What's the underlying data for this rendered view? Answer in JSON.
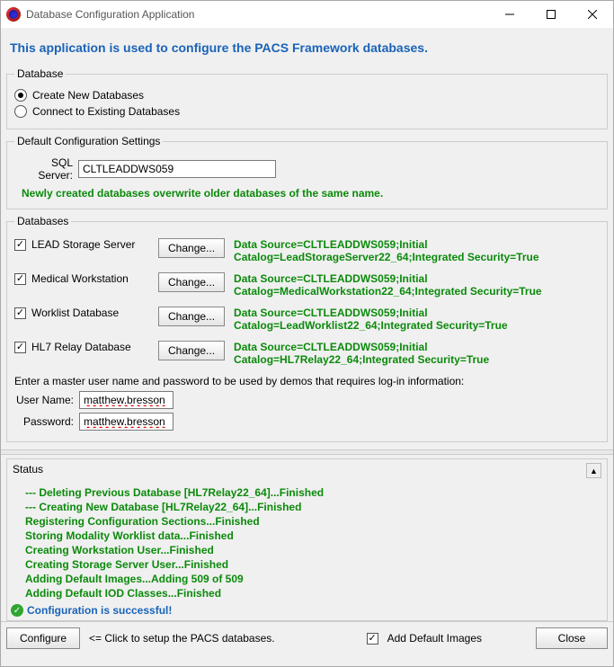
{
  "window": {
    "title": "Database Configuration Application"
  },
  "banner": "This application is used to configure the PACS Framework databases.",
  "database_group": {
    "legend": "Database",
    "opt_create": "Create New Databases",
    "opt_connect": "Connect to Existing Databases"
  },
  "config_group": {
    "legend": "Default Configuration Settings",
    "sql_label": "SQL Server:",
    "sql_value": "CLTLEADDWS059",
    "warning": "Newly created databases overwrite older databases of the same name."
  },
  "databases_group": {
    "legend": "Databases",
    "change_label": "Change...",
    "items": [
      {
        "name": "LEAD Storage Server",
        "conn": "Data Source=CLTLEADDWS059;Initial Catalog=LeadStorageServer22_64;Integrated Security=True"
      },
      {
        "name": "Medical Workstation",
        "conn": "Data Source=CLTLEADDWS059;Initial Catalog=MedicalWorkstation22_64;Integrated Security=True"
      },
      {
        "name": "Worklist Database",
        "conn": "Data Source=CLTLEADDWS059;Initial Catalog=LeadWorklist22_64;Integrated Security=True"
      },
      {
        "name": "HL7 Relay Database",
        "conn": "Data Source=CLTLEADDWS059;Initial Catalog=HL7Relay22_64;Integrated Security=True"
      }
    ],
    "prompt": "Enter a master user name and password to be used by demos that requires log-in information:",
    "user_label": "User Name:",
    "user_value": "matthew.bresson",
    "pass_label": "Password:",
    "pass_value": "matthew.bresson"
  },
  "status": {
    "legend": "Status",
    "lines": [
      "--- Deleting Previous Database [HL7Relay22_64]...Finished",
      "--- Creating New Database [HL7Relay22_64]...Finished",
      "Registering Configuration Sections...Finished",
      "Storing Modality Worklist data...Finished",
      "Creating Workstation User...Finished",
      "Creating Storage Server User...Finished",
      "Adding Default Images...Adding 509 of 509",
      "Adding Default IOD Classes...Finished"
    ],
    "success": "Configuration is successful!"
  },
  "bottom": {
    "configure": "Configure",
    "hint": "<= Click to setup the PACS databases.",
    "add_images": "Add Default Images",
    "close": "Close"
  }
}
